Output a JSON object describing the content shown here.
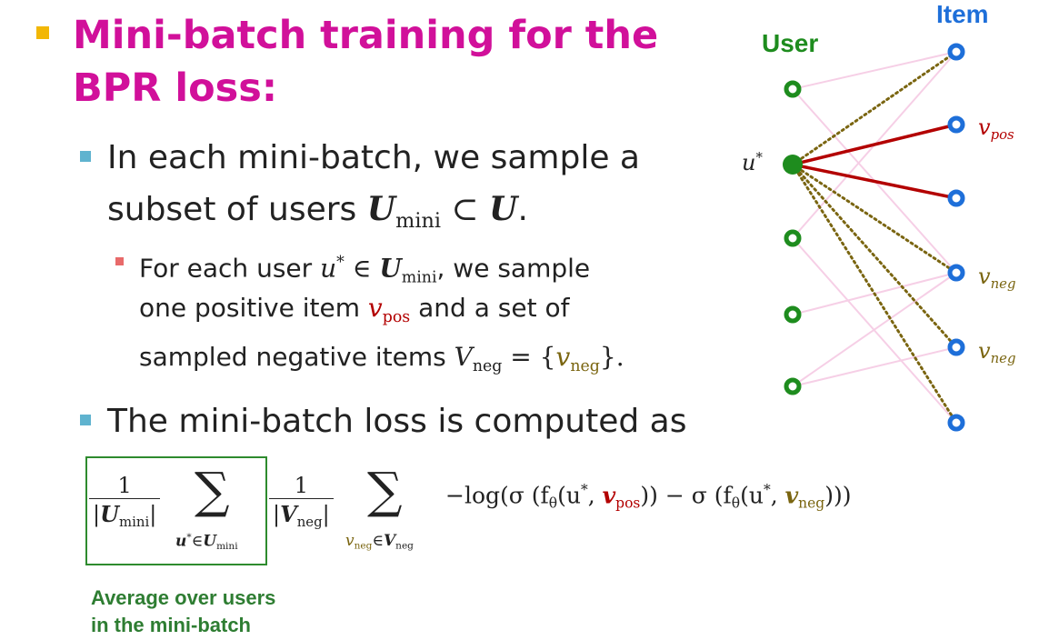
{
  "title": "Mini-batch training for the BPR loss:",
  "bullets": {
    "b1_line1": "In each mini-batch, we sample a",
    "b1_line2_pre": "subset of users",
    "b1_U": "U",
    "b1_mini": "mini",
    "b1_subset": " ⊂ ",
    "b1_U2": "U",
    "b1_end": ".",
    "s1_pre": "For each user",
    "s1_u": "u",
    "s1_star": "*",
    "s1_in": " ∈ ",
    "s1_U": "U",
    "s1_mini": "mini",
    "s1_post": ", we sample",
    "s2_pre": "one positive item",
    "s2_v": "v",
    "s2_pos": "pos",
    "s2_post": "and a set of",
    "s3_pre": "sampled negative items",
    "s3_V": "V",
    "s3_neg": "neg",
    "s3_eq": " = {",
    "s3_v": "v",
    "s3_neg2": "neg",
    "s3_end": "}.",
    "b2": "The mini-batch loss is computed as"
  },
  "formula": {
    "one": "1",
    "U": "U",
    "mini": "mini",
    "sum": "∑",
    "sum_u": "u",
    "sum_star": "*",
    "sum_in": "∈",
    "sum_U": "U",
    "sum_mini": "mini",
    "V": "V",
    "neg": "neg",
    "sum_v": "v",
    "sum_vneg": "neg",
    "sum_in2": "∈",
    "sum_V": "V",
    "sum_Vneg": "neg",
    "log": "−log",
    "body_a": "(σ (f",
    "theta": "θ",
    "body_b": "(u",
    "body_star": "*",
    "body_comma": ", ",
    "v": "v",
    "pos": "pos",
    "body_c": ")) − σ (f",
    "theta2": "θ",
    "body_d": "(u",
    "body_star2": "*",
    "body_comma2": ", ",
    "v2": "v",
    "neg2": "neg",
    "body_e": ")))"
  },
  "avg_label_line1": "Average over users",
  "avg_label_line2": "in the mini-batch",
  "graph": {
    "user_label": "User",
    "item_label": "Item",
    "ustar": "u",
    "ustar_sup": "*",
    "vpos": "v",
    "vpos_sub": "pos",
    "vneg1": "v",
    "vneg1_sub": "neg",
    "vneg2": "v",
    "vneg2_sub": "neg"
  },
  "colors": {
    "title": "#d1109a",
    "user_node": "#1e8c1e",
    "item_node": "#1e6fd9",
    "pos_edge": "#b30000",
    "neg_edge": "#7a6510",
    "bg_edge": "#f6cfe6",
    "box": "#2e8b2e"
  }
}
